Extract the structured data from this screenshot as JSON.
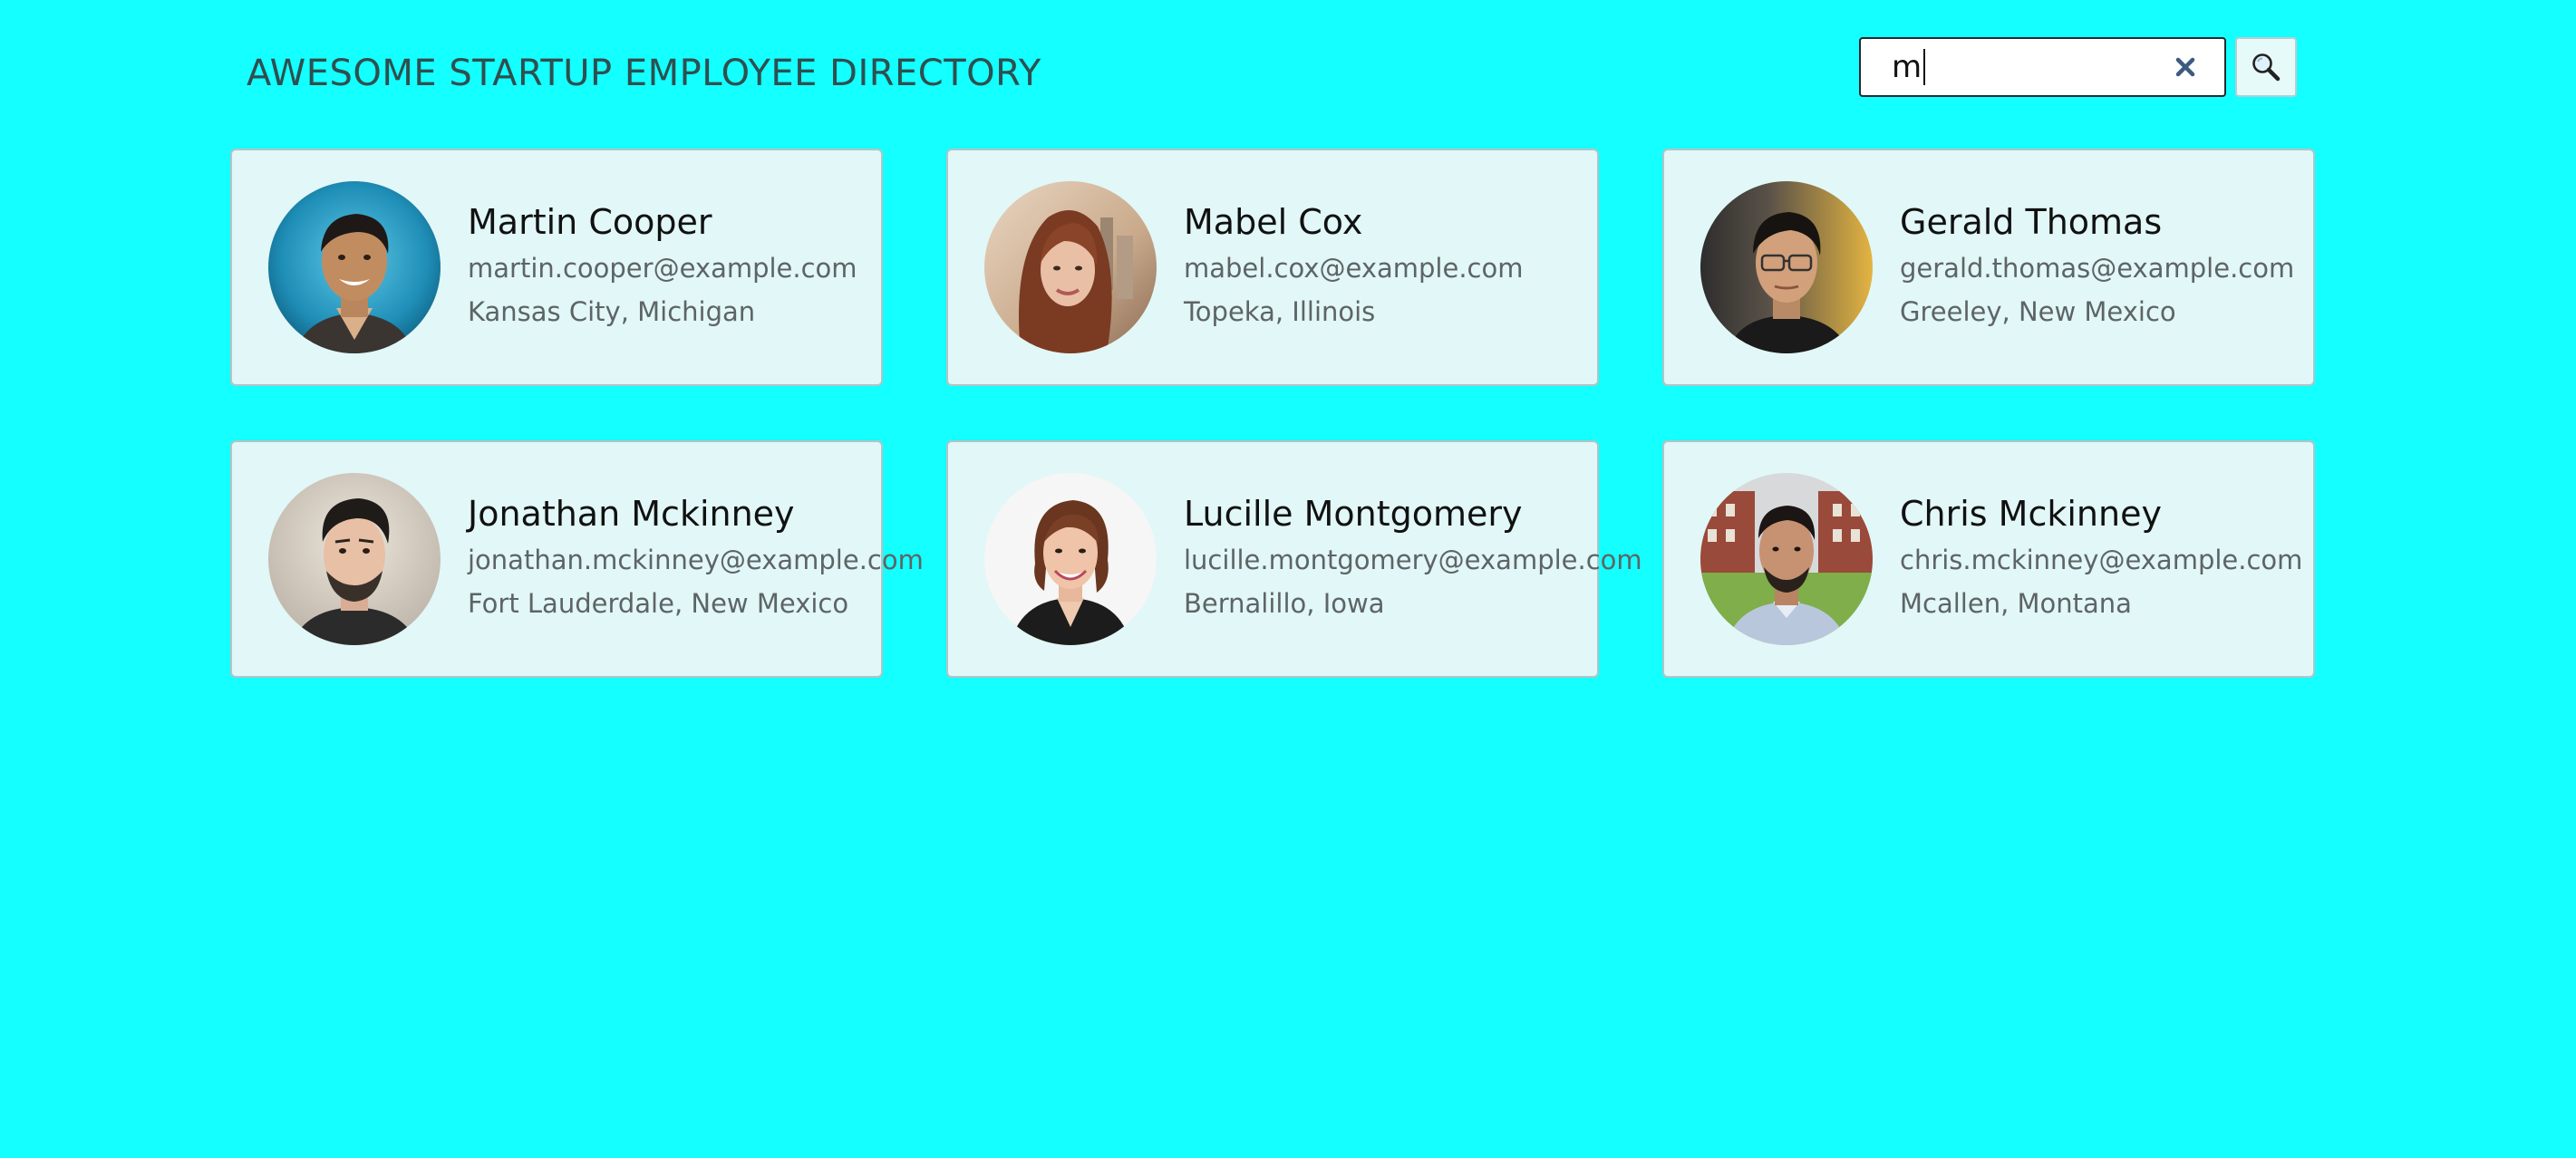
{
  "header": {
    "title": "AWESOME STARTUP EMPLOYEE DIRECTORY"
  },
  "search": {
    "value": "m",
    "clear_icon": "close-icon",
    "button_icon": "search-icon"
  },
  "employees": [
    {
      "name": "Martin Cooper",
      "email": "martin.cooper@example.com",
      "location": "Kansas City, Michigan"
    },
    {
      "name": "Mabel Cox",
      "email": "mabel.cox@example.com",
      "location": "Topeka, Illinois"
    },
    {
      "name": "Gerald Thomas",
      "email": "gerald.thomas@example.com",
      "location": "Greeley, New Mexico"
    },
    {
      "name": "Jonathan Mckinney",
      "email": "jonathan.mckinney@example.com",
      "location": "Fort Lauderdale, New Mexico"
    },
    {
      "name": "Lucille Montgomery",
      "email": "lucille.montgomery@example.com",
      "location": "Bernalillo, Iowa"
    },
    {
      "name": "Chris Mckinney",
      "email": "chris.mckinney@example.com",
      "location": "Mcallen, Montana"
    }
  ],
  "colors": {
    "page_background": "#14ffff",
    "card_background": "#e2f7f7",
    "title_text": "#2f4f50",
    "clear_icon": "#3d5a80"
  }
}
